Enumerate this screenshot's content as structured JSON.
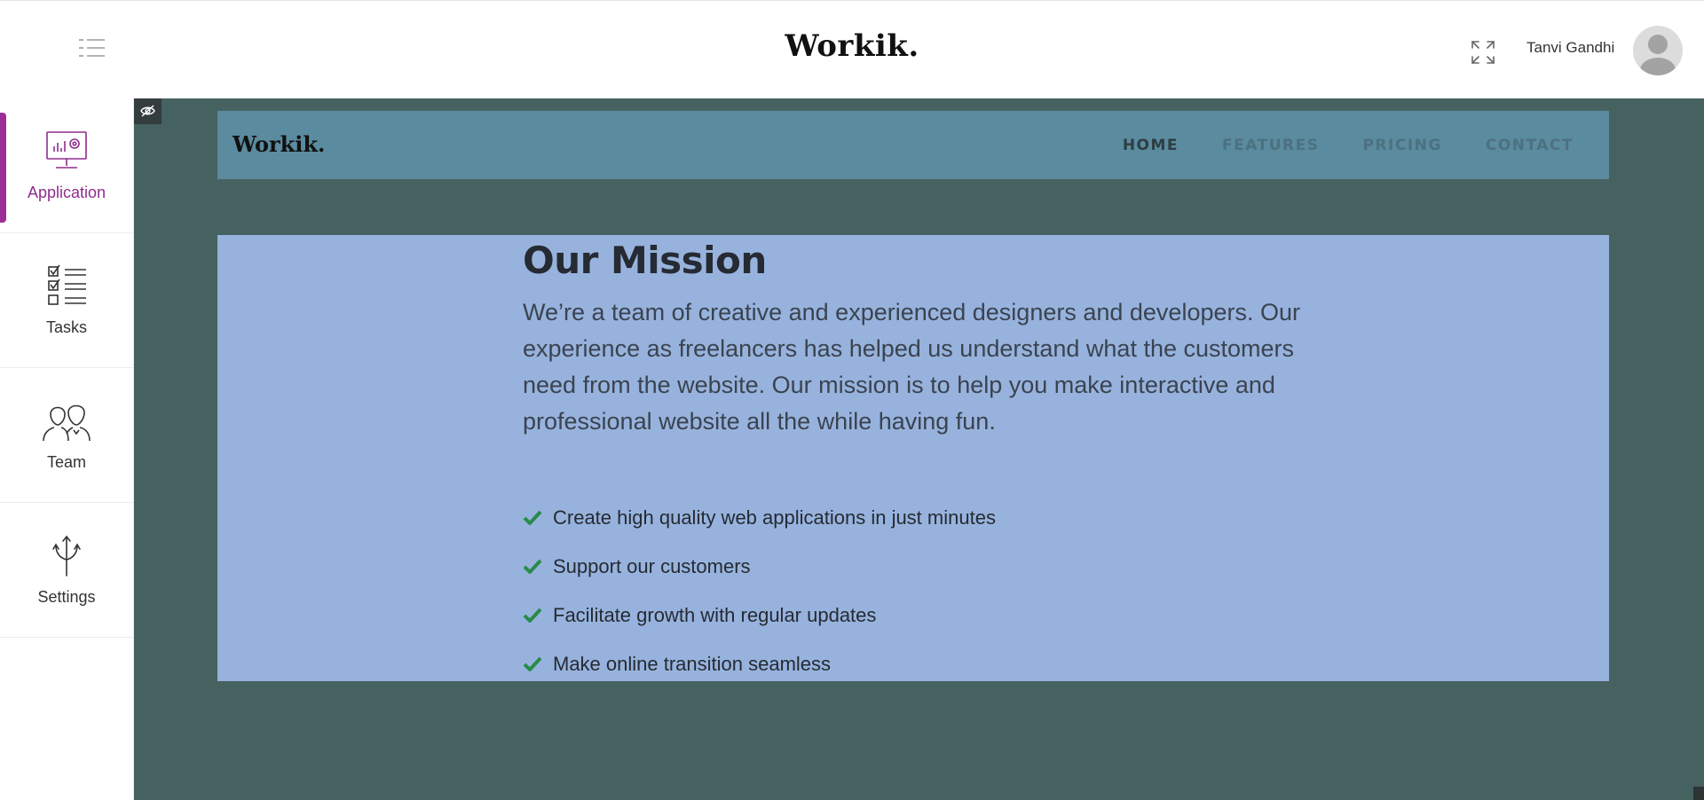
{
  "header": {
    "brand": "Workik.",
    "user_name": "Tanvi Gandhi"
  },
  "sidebar": {
    "items": [
      {
        "label": "Application",
        "icon": "monitor-chart-icon",
        "active": true
      },
      {
        "label": "Tasks",
        "icon": "checklist-icon",
        "active": false
      },
      {
        "label": "Team",
        "icon": "team-icon",
        "active": false
      },
      {
        "label": "Settings",
        "icon": "arrows-icon",
        "active": false
      }
    ]
  },
  "preview": {
    "logo": "Workik.",
    "nav": [
      "HOME",
      "FEATURES",
      "PRICING",
      "CONTACT"
    ],
    "mission": {
      "title": "Our Mission",
      "body": "We’re a team of creative and experienced designers and developers. Our experience as freelancers has helped us understand what the customers need from the website. Our mission is to help you make interactive and professional website all the while having fun.",
      "features": [
        "Create high quality web applications in just minutes",
        "Support our customers",
        "Facilitate growth with regular updates",
        "Make online transition seamless"
      ]
    }
  },
  "colors": {
    "accent": "#9b2f97",
    "canvas_bg": "#466260",
    "preview_nav_bg": "#5a8b9e",
    "mission_bg": "#97b3dd",
    "check": "#2a8a4a"
  }
}
